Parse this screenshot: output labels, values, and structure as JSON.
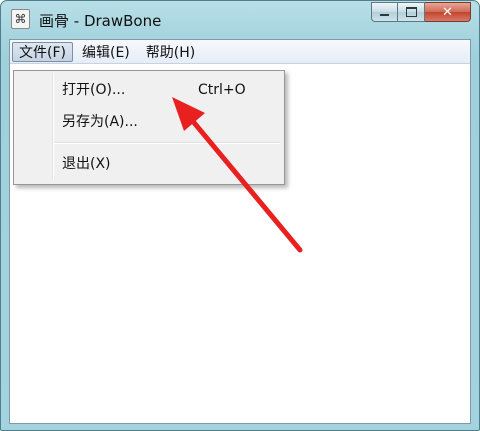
{
  "window": {
    "title": "画骨 - DrawBone",
    "icon": "app-bone-icon",
    "controls": {
      "minimize": "minimize-icon",
      "maximize": "maximize-icon",
      "close_glyph": "✕"
    }
  },
  "menubar": {
    "items": [
      {
        "label": "文件(F)",
        "active": true
      },
      {
        "label": "编辑(E)"
      },
      {
        "label": "帮助(H)"
      }
    ]
  },
  "file_menu": {
    "items": [
      {
        "label": "打开(O)...",
        "shortcut": "Ctrl+O"
      },
      {
        "label": "另存为(A)..."
      },
      {
        "label": "退出(X)"
      }
    ]
  },
  "annotation": {
    "type": "arrow",
    "color": "#e8201f"
  }
}
